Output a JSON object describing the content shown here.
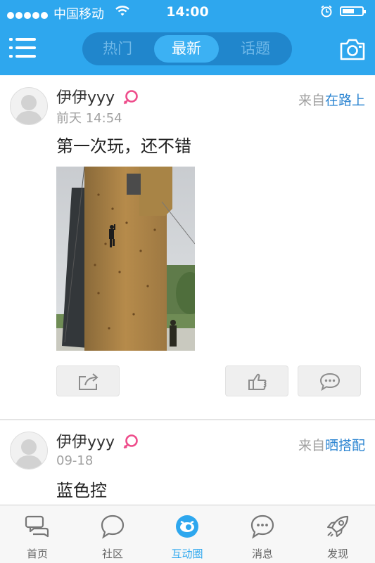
{
  "status_bar": {
    "carrier": "中国移动",
    "time": "14:00"
  },
  "nav": {
    "menu_icon": "menu-icon",
    "tabs": [
      {
        "label": "热门",
        "active": false
      },
      {
        "label": "最新",
        "active": true
      },
      {
        "label": "话题",
        "active": false
      }
    ],
    "camera_icon": "camera-icon"
  },
  "posts": [
    {
      "username": "伊伊yyy",
      "gender": "female",
      "time": "前天 14:54",
      "source_prefix": "来自",
      "source_place": "在路上",
      "content": "第一次玩，还不错",
      "has_photo": true
    },
    {
      "username": "伊伊yyy",
      "gender": "female",
      "time": "09-18",
      "source_prefix": "来自",
      "source_place": "晒搭配",
      "content": "蓝色控"
    }
  ],
  "actions": {
    "share_icon": "share-icon",
    "like_icon": "thumbs-up-icon",
    "comment_icon": "comment-icon"
  },
  "tabbar": [
    {
      "label": "首页",
      "icon": "home-chat-icon",
      "active": false
    },
    {
      "label": "社区",
      "icon": "community-bubble-icon",
      "active": false
    },
    {
      "label": "互动圈",
      "icon": "interaction-eye-icon",
      "active": true
    },
    {
      "label": "消息",
      "icon": "message-bubble-icon",
      "active": false
    },
    {
      "label": "发现",
      "icon": "rocket-icon",
      "active": false
    }
  ],
  "colors": {
    "accent": "#2ea7ee",
    "place_link": "#2b84d1",
    "female": "#ee4b8a"
  }
}
